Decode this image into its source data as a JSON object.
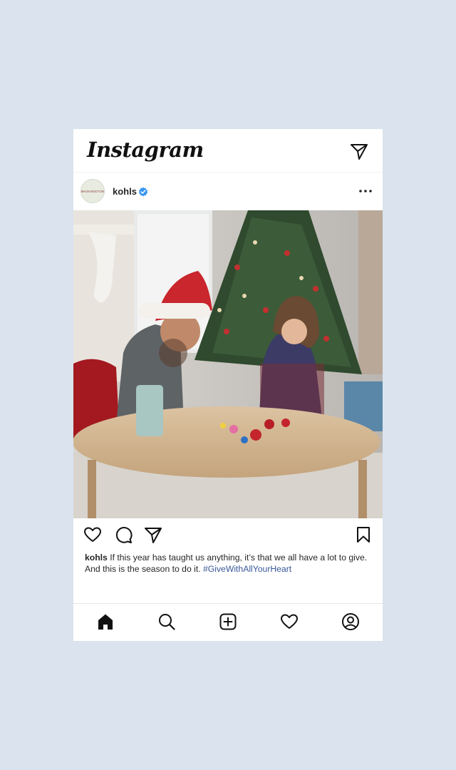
{
  "app": {
    "logo_text": "Instagram"
  },
  "post": {
    "username": "kohls",
    "avatar_text": "WASHINGTON",
    "caption_text": "If this year has taught us anything, it’s that we all have a lot to give. And this is the season to do it.",
    "hashtag": "#GiveWithAllYourHeart"
  },
  "icons": {
    "direct": "paper-plane-icon",
    "verified": "verified-badge-icon",
    "more": "more-options-icon",
    "like": "heart-icon",
    "comment": "comment-icon",
    "share": "share-icon",
    "save": "bookmark-icon",
    "home": "home-icon",
    "search": "search-icon",
    "create": "plus-square-icon",
    "activity": "heart-icon",
    "profile": "profile-icon"
  },
  "colors": {
    "background": "#dae3ee",
    "verified_blue": "#3897f0",
    "hashtag": "#385898",
    "text": "#262626"
  }
}
